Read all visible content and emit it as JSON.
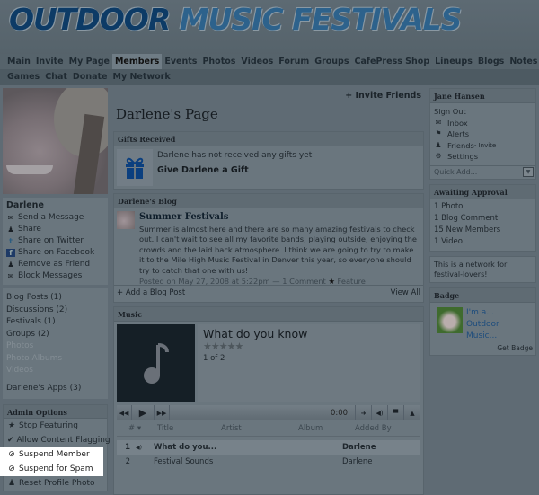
{
  "site": {
    "title_part1": "OUTDOOR",
    "title_part2": "MUSIC FESTIVALS"
  },
  "nav": {
    "row1": [
      "Main",
      "Invite",
      "My Page",
      "Members",
      "Events",
      "Photos",
      "Videos",
      "Forum",
      "Groups",
      "CafePress Shop",
      "Lineups",
      "Blogs",
      "Notes"
    ],
    "row2": [
      "Games",
      "Chat",
      "Donate",
      "My Network"
    ],
    "active": "Members"
  },
  "profile": {
    "name": "Darlene",
    "actions": [
      {
        "icon": "envelope-icon",
        "label": "Send a Message"
      },
      {
        "icon": "share-icon",
        "label": "Share"
      },
      {
        "icon": "twitter-icon",
        "label": "Share on Twitter"
      },
      {
        "icon": "facebook-icon",
        "label": "Share on Facebook"
      },
      {
        "icon": "remove-friend-icon",
        "label": "Remove as Friend"
      },
      {
        "icon": "block-messages-icon",
        "label": "Block Messages"
      }
    ],
    "counts": [
      {
        "label": "Blog Posts (1)",
        "dim": false
      },
      {
        "label": "Discussions (2)",
        "dim": false
      },
      {
        "label": "Festivals (1)",
        "dim": false
      },
      {
        "label": "Groups (2)",
        "dim": false
      },
      {
        "label": "Photos",
        "dim": true
      },
      {
        "label": "Photo Albums",
        "dim": true
      },
      {
        "label": "Videos",
        "dim": true
      }
    ],
    "apps": "Darlene's Apps (3)"
  },
  "admin": {
    "title": "Admin Options",
    "items": [
      {
        "icon": "star-icon",
        "label": "Stop Featuring"
      },
      {
        "icon": "check-icon",
        "label": "Allow Content Flagging"
      },
      {
        "icon": "ban-icon",
        "label": "Suspend Member"
      },
      {
        "icon": "ban-icon",
        "label": "Suspend for Spam"
      },
      {
        "icon": "user-icon",
        "label": "Reset Profile Photo"
      }
    ]
  },
  "main": {
    "invite": "+ Invite Friends",
    "page_title": "Darlene's Page",
    "gifts": {
      "title": "Gifts Received",
      "empty": "Darlene has not received any gifts yet",
      "give": "Give Darlene a Gift"
    },
    "blog": {
      "title": "Darlene's Blog",
      "post_title": "Summer Festivals",
      "post_body": "Summer is almost here and there are so many amazing festivals to check out. I can't wait to see all my favorite bands, playing outside, enjoying the crowds and the laid back atmosphere. I think we are going to try to make it to the Mile High Music Festival in Denver this year, so everyone should try to catch that one with us!",
      "meta": "Posted on May 27, 2008 at 5:22pm — 1 Comment",
      "feature": "Feature",
      "add": "+ Add a Blog Post",
      "view_all": "View All"
    },
    "music": {
      "title": "Music",
      "track_title": "What do you know",
      "rating": 0,
      "position": "1 of 2",
      "time": "0:00",
      "columns": [
        "# ▾",
        "Title",
        "Artist",
        "Album",
        "Added By"
      ],
      "tracks": [
        {
          "num": "1",
          "title": "What do you...",
          "artist": "",
          "album": "",
          "added_by": "Darlene",
          "playing": true
        },
        {
          "num": "2",
          "title": "Festival Sounds",
          "artist": "",
          "album": "",
          "added_by": "Darlene",
          "playing": false
        }
      ]
    }
  },
  "user": {
    "name": "Jane Hansen",
    "sign_out": "Sign Out",
    "links": [
      {
        "icon": "inbox-icon",
        "label": "Inbox"
      },
      {
        "icon": "alerts-icon",
        "label": "Alerts"
      },
      {
        "icon": "friends-icon",
        "label": "Friends",
        "extra": " - Invite"
      },
      {
        "icon": "settings-icon",
        "label": "Settings"
      }
    ],
    "quick_add": "Quick Add..."
  },
  "approval": {
    "title": "Awaiting Approval",
    "items": [
      "1 Photo",
      "1 Blog Comment",
      "15 New Members",
      "1 Video"
    ]
  },
  "about": "This is a network for festival-lovers!",
  "badge": {
    "title": "Badge",
    "line1": "I'm a...",
    "line2": "Outdoor",
    "line3": "Music...",
    "get": "Get Badge"
  }
}
